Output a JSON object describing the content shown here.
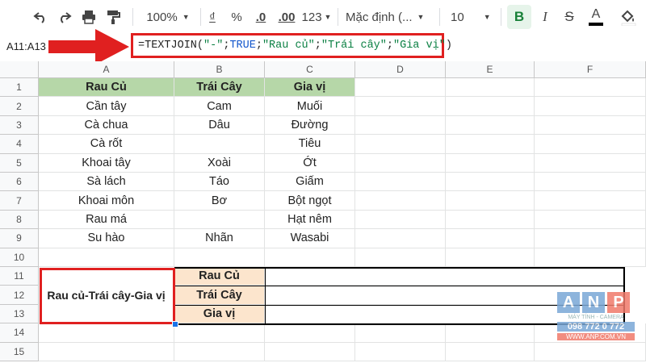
{
  "toolbar": {
    "zoom": "100%",
    "currency": "₫",
    "percent": "%",
    "dec_decrease": ".0",
    "dec_increase": ".00",
    "number_format": "123",
    "font_family": "Mặc định (...",
    "font_size": "10",
    "bold": "B",
    "italic": "I",
    "strike": "S",
    "text_color": "A"
  },
  "formula_bar": {
    "cell_ref": "A11:A13",
    "formula_parts": [
      {
        "text": "=TEXTJOIN(",
        "color": "#222222"
      },
      {
        "text": "\"-\"",
        "color": "#0b8043"
      },
      {
        "text": ";",
        "color": "#222222"
      },
      {
        "text": "TRUE",
        "color": "#1155cc"
      },
      {
        "text": ";",
        "color": "#222222"
      },
      {
        "text": "\"Rau củ\"",
        "color": "#0b8043"
      },
      {
        "text": ";",
        "color": "#222222"
      },
      {
        "text": "\"Trái cây\"",
        "color": "#0b8043"
      },
      {
        "text": ";",
        "color": "#222222"
      },
      {
        "text": "\"Gia vị\"",
        "color": "#0b8043"
      },
      {
        "text": ")",
        "color": "#222222"
      }
    ]
  },
  "columns": [
    "A",
    "B",
    "C",
    "D",
    "E",
    "F"
  ],
  "rows": [
    "1",
    "2",
    "3",
    "4",
    "5",
    "6",
    "7",
    "8",
    "9",
    "10",
    "11",
    "12",
    "13",
    "14",
    "15"
  ],
  "table": {
    "headers": [
      "Rau Củ",
      "Trái Cây",
      "Gia vị"
    ],
    "data": [
      [
        "Cần tây",
        "Cam",
        "Muối"
      ],
      [
        "Cà chua",
        "Dâu",
        "Đường"
      ],
      [
        "Cà rốt",
        "",
        "Tiêu"
      ],
      [
        "Khoai tây",
        "Xoài",
        "Ớt"
      ],
      [
        "Sà lách",
        "Táo",
        "Giấm"
      ],
      [
        "Khoai môn",
        "Bơ",
        "Bột ngọt"
      ],
      [
        "Rau má",
        "",
        "Hạt nêm"
      ],
      [
        "Su hào",
        "Nhãn",
        "Wasabi"
      ]
    ]
  },
  "result": {
    "merged_value": "Rau củ-Trái cây-Gia vị",
    "labels": [
      "Rau Củ",
      "Trái Cây",
      "Gia vị"
    ]
  },
  "watermark": {
    "letters": [
      "A",
      "N",
      "P"
    ],
    "tagline": "MÁY TÍNH - CAMERA",
    "phone": "098 772 0 772",
    "website": "WWW.ANP.COM.VN"
  },
  "colors": {
    "header_green": "#b6d7a8",
    "label_peach": "#fce5cd",
    "highlight_red": "#e02020",
    "accent_green": "#188038"
  }
}
